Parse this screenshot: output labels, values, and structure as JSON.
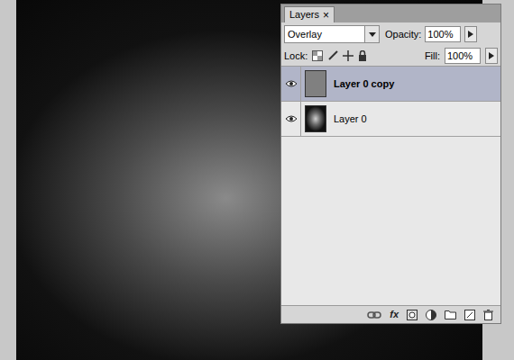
{
  "photo": {
    "kind": "black-and-white portrait"
  },
  "panel": {
    "title": "Layers",
    "close": "×"
  },
  "options": {
    "blend_mode": "Overlay",
    "opacity_label": "Opacity:",
    "opacity_value": "100%",
    "lock_label": "Lock:",
    "fill_label": "Fill:",
    "fill_value": "100%"
  },
  "layers": [
    {
      "name": "Layer 0 copy",
      "visible": true,
      "selected": true,
      "kind": "gray"
    },
    {
      "name": "Layer 0",
      "visible": true,
      "selected": false,
      "kind": "photo"
    }
  ],
  "footer": {
    "fx_label": "fx"
  }
}
